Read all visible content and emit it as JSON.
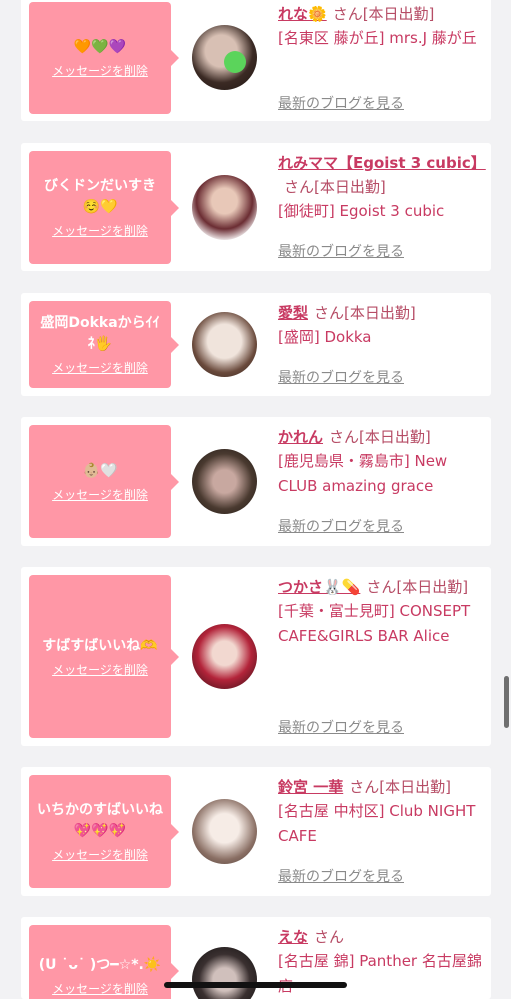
{
  "cards": [
    {
      "message": "🧡💚💜",
      "delete_label": "メッセージを削除",
      "name": "れな🌼",
      "san": "さん",
      "status": "[本日出勤]",
      "shop": "[名東区 藤が丘] mrs.J 藤が丘",
      "blog_label": "最新のブログを見る"
    },
    {
      "message": "びくドンだいすき☺️💛",
      "delete_label": "メッセージを削除",
      "name": "れみママ【Egoist 3 cubic】",
      "san": "さん",
      "status": "[本日出勤]",
      "shop": "[御徒町] Egoist 3 cubic",
      "blog_label": "最新のブログを見る"
    },
    {
      "message": "盛岡Dokkaからｲｲﾈ🖐",
      "delete_label": "メッセージを削除",
      "name": "愛梨",
      "san": "さん",
      "status": "[本日出勤]",
      "shop": "[盛岡] Dokka",
      "blog_label": "最新のブログを見る"
    },
    {
      "message": "👶🏼🤍",
      "delete_label": "メッセージを削除",
      "name": "かれん",
      "san": "さん",
      "status": "[本日出勤]",
      "shop": "[鹿児島県・霧島市] New CLUB amazing grace",
      "blog_label": "最新のブログを見る"
    },
    {
      "message": "すばすばいいね🫶",
      "delete_label": "メッセージを削除",
      "name": "つかさ🐰💊",
      "san": "さん",
      "status": "[本日出勤]",
      "shop": "[千葉・富士見町] CONSEPT CAFE&GIRLS BAR Alice",
      "blog_label": "最新のブログを見る"
    },
    {
      "message": "いちかのすばいいね💖💖💖",
      "delete_label": "メッセージを削除",
      "name": "鈴宮 一華",
      "san": "さん",
      "status": "[本日出勤]",
      "shop": "[名古屋 中村区] Club NIGHT CAFE",
      "blog_label": "最新のブログを見る"
    },
    {
      "message": "(U ˙ᴗ˙ )つ━☆*.☀️",
      "delete_label": "メッセージを削除",
      "name": "えな",
      "san": "さん",
      "status": "",
      "shop": "[名古屋 錦] Panther 名古屋錦店",
      "blog_label": ""
    }
  ],
  "colors": {
    "bubble": "#ff97a6",
    "link": "#c83a62",
    "background": "#f2f2f4"
  }
}
